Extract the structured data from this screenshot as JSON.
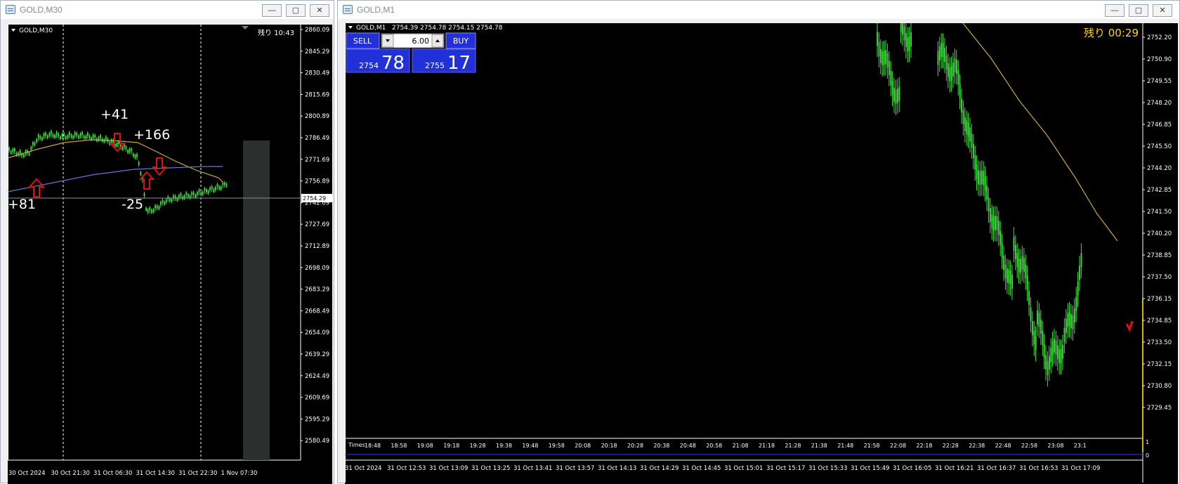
{
  "left_window": {
    "title": "GOLD,M30",
    "chart_label": "GOLD,M30",
    "remaining": "残り 10:43",
    "price_axis": [
      "2860.09",
      "2845.29",
      "2830.49",
      "2815.69",
      "2800.89",
      "2786.49",
      "2771.69",
      "2756.89",
      "2742.09",
      "2727.69",
      "2712.89",
      "2698.09",
      "2683.29",
      "2668.49",
      "2654.09",
      "2639.29",
      "2624.49",
      "2609.69",
      "2595.29",
      "2580.49"
    ],
    "current_price": "2754.29",
    "time_axis": [
      "30 Oct 2024",
      "30 Oct 21:30",
      "31 Oct 06:30",
      "31 Oct 14:30",
      "31 Oct 22:30",
      "1 Nov 07:30"
    ],
    "annotations": [
      "+41",
      "+166",
      "+81",
      "-25"
    ]
  },
  "right_window": {
    "title": "GOLD,M1",
    "chart_label": "GOLD,M1",
    "ohlc": "2754.39 2754.78 2754.15 2754.78",
    "remaining_label": "残り",
    "remaining_time": "00:29",
    "trade_panel": {
      "sell_label": "SELL",
      "buy_label": "BUY",
      "lot": "6.00",
      "sell_small": "2754",
      "sell_big": "78",
      "buy_small": "2755",
      "buy_big": "17"
    },
    "price_axis": [
      "2752.20",
      "2750.90",
      "2749.55",
      "2748.20",
      "2746.85",
      "2745.50",
      "2744.20",
      "2742.85",
      "2741.50",
      "2740.20",
      "2738.85",
      "2737.50",
      "2736.15",
      "2734.85",
      "2733.50",
      "2732.15",
      "2730.80",
      "2729.45"
    ],
    "sub_label": "Times",
    "sub_times": [
      "18:48",
      "18:58",
      "19:08",
      "19:18",
      "19:28",
      "19:38",
      "19:48",
      "19:58",
      "20:08",
      "20:18",
      "20:28",
      "20:38",
      "20:48",
      "20:58",
      "21:08",
      "21:18",
      "21:28",
      "21:38",
      "21:48",
      "21:58",
      "22:08",
      "22:18",
      "22:28",
      "22:38",
      "22:48",
      "22:58",
      "23:08",
      "23:1"
    ],
    "sub_axis": [
      "1",
      "0"
    ],
    "time_axis": [
      "31 Oct 2024",
      "31 Oct 12:53",
      "31 Oct 13:09",
      "31 Oct 13:25",
      "31 Oct 13:41",
      "31 Oct 13:57",
      "31 Oct 14:13",
      "31 Oct 14:29",
      "31 Oct 14:45",
      "31 Oct 15:01",
      "31 Oct 15:17",
      "31 Oct 15:33",
      "31 Oct 15:49",
      "31 Oct 16:05",
      "31 Oct 16:21",
      "31 Oct 16:37",
      "31 Oct 16:53",
      "31 Oct 17:09"
    ]
  },
  "colors": {
    "bull": "#3ee43e",
    "ma_fast": "#c8a93a",
    "ma_slow": "#6b74d8",
    "arrow": "#e01010",
    "panel_blue": "#2230d8"
  }
}
